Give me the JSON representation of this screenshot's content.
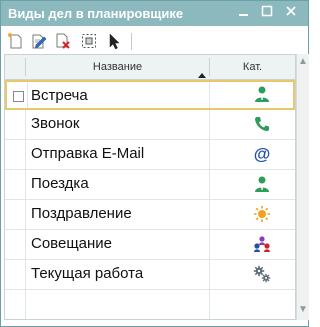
{
  "window": {
    "title": "Виды дел в планировщике"
  },
  "toolbar": {
    "items": [
      "new-item-icon",
      "edit-item-icon",
      "delete-item-icon",
      "select-frame-icon",
      "pointer-icon"
    ]
  },
  "table": {
    "columns": {
      "name": "Название",
      "category": "Кат."
    },
    "rows": [
      {
        "name": "Встреча",
        "icon": "person-icon",
        "color": "#2e9c5a"
      },
      {
        "name": "Звонок",
        "icon": "phone-icon",
        "color": "#2e9c5a"
      },
      {
        "name": "Отправка E-Mail",
        "icon": "at-icon",
        "color": "#1f4fa8"
      },
      {
        "name": "Поездка",
        "icon": "person-icon",
        "color": "#2e9c5a"
      },
      {
        "name": "Поздравление",
        "icon": "sun-icon",
        "color": "#f0a21c"
      },
      {
        "name": "Совещание",
        "icon": "group-icon",
        "color": "#8e3ab0"
      },
      {
        "name": "Текущая работа",
        "icon": "gears-icon",
        "color": "#5c6e7a"
      }
    ]
  },
  "colors": {
    "titlebar": "#8cb9bd",
    "selection": "#e8c86a"
  }
}
